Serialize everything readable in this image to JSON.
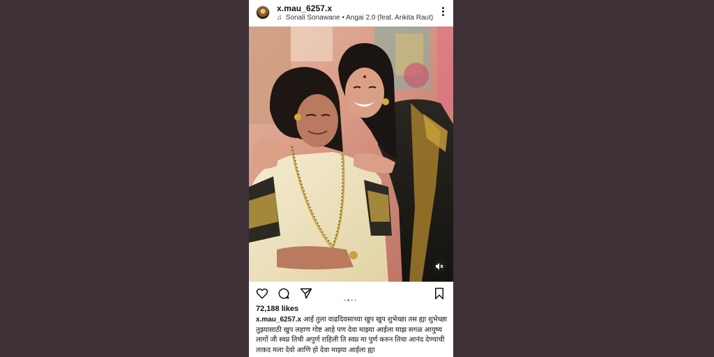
{
  "post": {
    "username": "x.mau_6257.x",
    "audio": "Sonali Sonawane • Angai 2.0 (feat. Ankita Raut)",
    "likes": "72,188 likes",
    "caption_user": "x.mau_6257.x",
    "caption_text": "आई तुला वाढदिवसाच्या खुप खुप शुभेच्छा तस ह्या शुभेच्छा तुझ्यासाठी खुप लहाण गोष्ट आहे पण देवा माझ्या आईला माझ सगळ आयुष्य लागों जी स्वप्न तिची अपुर्ण राहिली ति स्वप्न मा पुर्ण करुन तिचा आनंद देण्याची ताकद मला देवो आणि हो देवा माझ्या आईला ह्या",
    "carousel": {
      "total": 4,
      "active_index": 1
    }
  },
  "icons": {
    "avatar": "avatar",
    "music": "music-note-icon",
    "more": "more-vertical-icon",
    "mute": "muted-speaker-icon",
    "like": "heart-icon",
    "comment": "comment-icon",
    "share": "send-icon",
    "save": "bookmark-icon"
  },
  "colors": {
    "background": "#3d3137",
    "card": "#ffffff",
    "carousel_active": "#3797f0"
  }
}
